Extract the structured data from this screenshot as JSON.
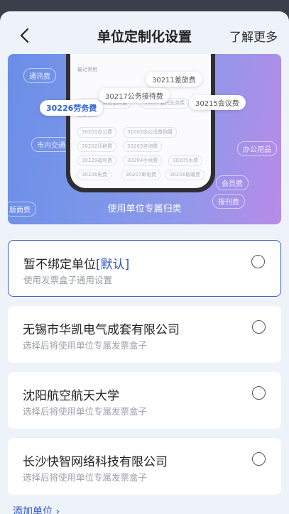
{
  "header": {
    "title": "单位定制化设置",
    "learn_more": "了解更多"
  },
  "banner": {
    "caption": "使用单位专属归类",
    "bg_labels": [
      "通讯费",
      "市内交通",
      "办公用品",
      "会员费",
      "报刊费",
      "版面费"
    ],
    "screen": {
      "recent_label": "最近常用",
      "all_label": "全部归类",
      "faint_recent": [
        "30205专用设备购置",
        "30227委托业务费"
      ],
      "categories": [
        [
          "30201办公费",
          "31002办公设备购置"
        ],
        [
          "30202印刷费",
          "30203咨询费"
        ],
        [
          "30229福利费",
          "30204手续费",
          "30205水费"
        ],
        [
          "30206电费",
          "30207邮电费",
          "30208取暖费"
        ]
      ]
    },
    "tags": {
      "t1": "30211差旅费",
      "t2": "30217公务接待费",
      "t3": "30226劳务费",
      "t4": "30215会议费"
    }
  },
  "options": [
    {
      "title_main": "暂不绑定单位",
      "title_suffix": "[默认]",
      "subtitle": "使用发票盒子通用设置",
      "selected": false
    },
    {
      "title_main": "无锡市华凯电气成套有限公司",
      "title_suffix": "",
      "subtitle": "选择后将使用单位专属发票盒子",
      "selected": false
    },
    {
      "title_main": "沈阳航空航天大学",
      "title_suffix": "",
      "subtitle": "选择后将使用单位专属发票盒子",
      "selected": false
    },
    {
      "title_main": "长沙快智网络科技有限公司",
      "title_suffix": "",
      "subtitle": "选择后将使用单位专属发票盒子",
      "selected": false
    }
  ],
  "add_unit": "添加单位 ›",
  "colors": {
    "accent": "#2d55c8",
    "banner_start": "#6b8ee6",
    "banner_end": "#b88be8"
  }
}
